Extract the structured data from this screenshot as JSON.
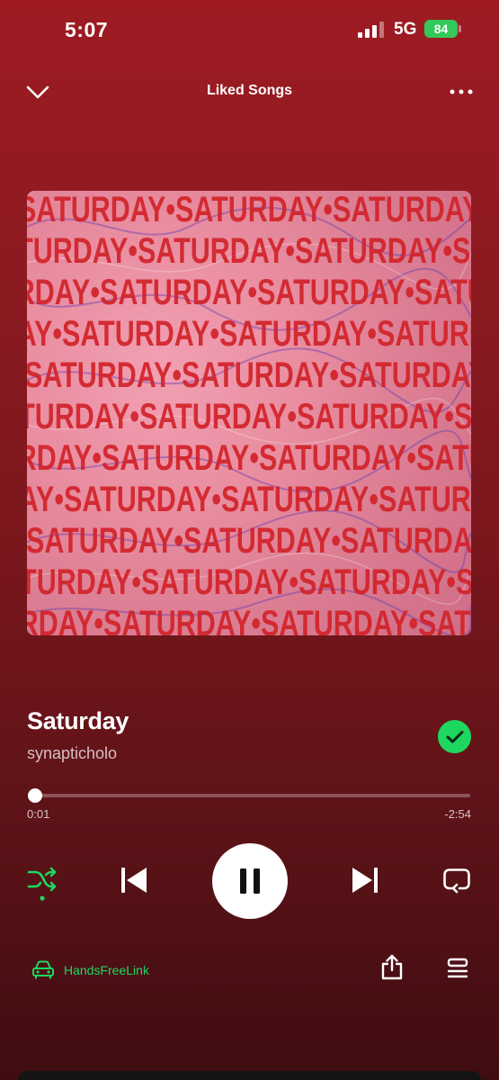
{
  "status_bar": {
    "time": "5:07",
    "network": "5G",
    "battery": "84"
  },
  "header": {
    "playlist_title": "Liked Songs",
    "collapse_icon": "chevron-down-icon",
    "more_icon": "more-dots-icon"
  },
  "album_art": {
    "text": "SATURDAY",
    "separator": "•",
    "colors": {
      "text": "#d2232a",
      "background": "#e98da0",
      "swirl": "#6a3fb0"
    }
  },
  "track": {
    "title": "Saturday",
    "artist": "synapticholo",
    "liked": true
  },
  "progress": {
    "elapsed": "0:01",
    "remaining": "-2:54",
    "fraction": 0.006
  },
  "controls": {
    "shuffle_icon": "shuffle-icon",
    "shuffle_active": true,
    "previous_icon": "skip-previous-icon",
    "play_state": "playing",
    "pause_icon": "pause-icon",
    "next_icon": "skip-next-icon",
    "repeat_icon": "repeat-icon"
  },
  "device": {
    "label": "HandsFreeLink",
    "icon": "car-icon"
  },
  "actions": {
    "share_icon": "share-icon",
    "queue_icon": "queue-icon"
  },
  "colors": {
    "accent": "#1ed760",
    "background_top": "#9e1b22",
    "background_bottom": "#3f0d11"
  }
}
